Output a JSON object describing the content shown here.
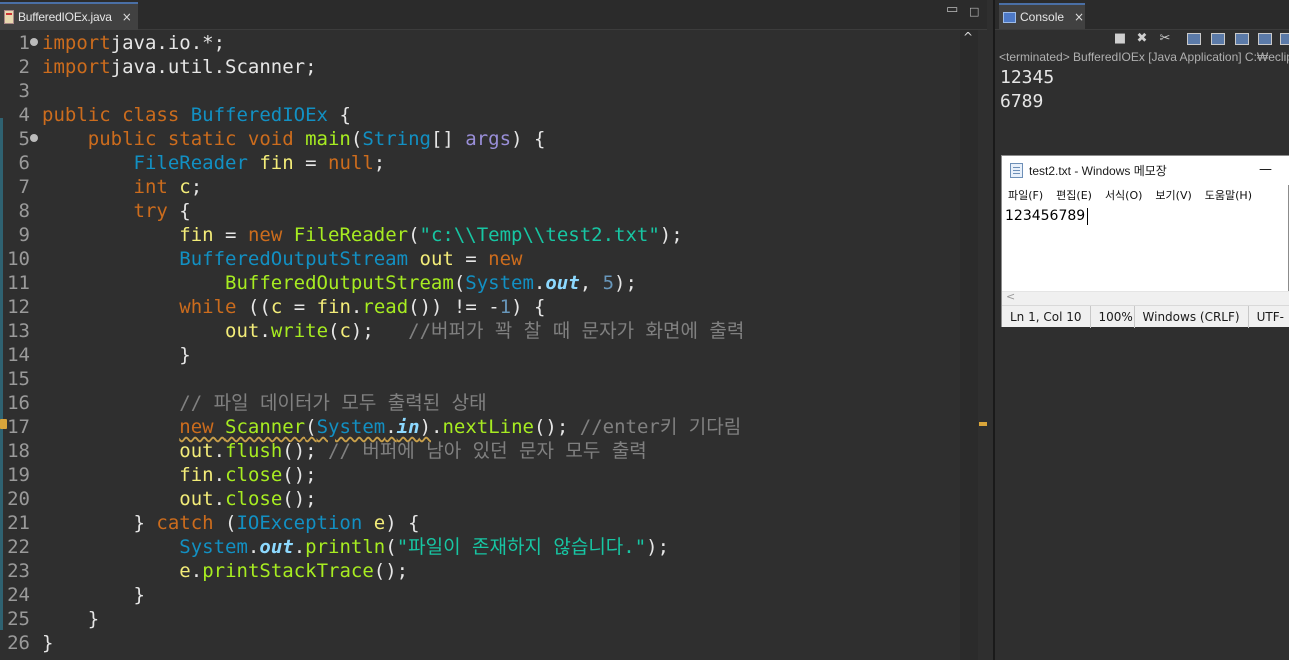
{
  "editor": {
    "tab_label": "BufferedIOEx.java",
    "close_glyph": "×",
    "min_glyph": "▭",
    "max_glyph": "□",
    "lines": [
      {
        "n": "1",
        "fold": true,
        "src": [
          [
            "kw",
            "import"
          ],
          [
            "",
            "java.io.*;"
          ]
        ]
      },
      {
        "n": "2",
        "src": [
          [
            "kw",
            "import"
          ],
          [
            "",
            "java.util.Scanner;"
          ]
        ]
      },
      {
        "n": "3",
        "src": []
      },
      {
        "n": "4",
        "src": [
          [
            "kw",
            "public class "
          ],
          [
            "cls",
            "BufferedIOEx"
          ],
          [
            "",
            " {"
          ]
        ]
      },
      {
        "n": "5",
        "fold": true,
        "src": [
          [
            "",
            "    "
          ],
          [
            "kw",
            "public static void "
          ],
          [
            "fn",
            "main"
          ],
          [
            "",
            "("
          ],
          [
            "cls",
            "String"
          ],
          [
            "",
            "[] "
          ],
          [
            "iface",
            "args"
          ],
          [
            "",
            ") {"
          ]
        ]
      },
      {
        "n": "6",
        "src": [
          [
            "",
            "        "
          ],
          [
            "cls",
            "FileReader "
          ],
          [
            "var",
            "fin"
          ],
          [
            "",
            " = "
          ],
          [
            "kw",
            "null"
          ],
          [
            "",
            ";"
          ]
        ]
      },
      {
        "n": "7",
        "src": [
          [
            "",
            "        "
          ],
          [
            "kw",
            "int "
          ],
          [
            "var",
            "c"
          ],
          [
            "",
            ";"
          ]
        ]
      },
      {
        "n": "8",
        "src": [
          [
            "",
            "        "
          ],
          [
            "kw",
            "try"
          ],
          [
            "",
            " {"
          ]
        ]
      },
      {
        "n": "9",
        "src": [
          [
            "",
            "            "
          ],
          [
            "var",
            "fin"
          ],
          [
            "",
            " = "
          ],
          [
            "kw",
            "new "
          ],
          [
            "fn",
            "FileReader"
          ],
          [
            "",
            "("
          ],
          [
            "str",
            "\"c:\\\\Temp\\\\test2.txt\""
          ],
          [
            "",
            ");"
          ]
        ]
      },
      {
        "n": "10",
        "src": [
          [
            "",
            "            "
          ],
          [
            "cls",
            "BufferedOutputStream "
          ],
          [
            "var",
            "out"
          ],
          [
            "",
            " = "
          ],
          [
            "kw",
            "new"
          ]
        ]
      },
      {
        "n": "11",
        "src": [
          [
            "",
            "                "
          ],
          [
            "fn",
            "BufferedOutputStream"
          ],
          [
            "",
            "("
          ],
          [
            "cls",
            "System"
          ],
          [
            "",
            "."
          ],
          [
            "stat",
            "out"
          ],
          [
            "",
            ", "
          ],
          [
            "num",
            "5"
          ],
          [
            "",
            ");"
          ]
        ]
      },
      {
        "n": "12",
        "src": [
          [
            "",
            "            "
          ],
          [
            "kw",
            "while "
          ],
          [
            "",
            "(("
          ],
          [
            "var",
            "c"
          ],
          [
            "",
            " = "
          ],
          [
            "var",
            "fin"
          ],
          [
            "",
            "."
          ],
          [
            "fn",
            "read"
          ],
          [
            "",
            "()) != -"
          ],
          [
            "num",
            "1"
          ],
          [
            "",
            ") {"
          ]
        ]
      },
      {
        "n": "13",
        "src": [
          [
            "",
            "                "
          ],
          [
            "var",
            "out"
          ],
          [
            "",
            "."
          ],
          [
            "fn",
            "write"
          ],
          [
            "",
            "("
          ],
          [
            "var",
            "c"
          ],
          [
            "",
            ");   "
          ],
          [
            "cmt",
            "//버퍼가 꽉 찰 때 문자가 화면에 출력"
          ]
        ]
      },
      {
        "n": "14",
        "src": [
          [
            "",
            "            }"
          ]
        ]
      },
      {
        "n": "15",
        "src": []
      },
      {
        "n": "16",
        "src": [
          [
            "",
            "            "
          ],
          [
            "cmt",
            "// 파일 데이터가 모두 출력된 상태"
          ]
        ]
      },
      {
        "n": "17",
        "src": [
          [
            "",
            "            "
          ],
          [
            "kwwarn",
            "new "
          ],
          [
            "fnwarn",
            "Scanner"
          ],
          [
            "warn",
            "("
          ],
          [
            "clswarn",
            "System"
          ],
          [
            "warn",
            "."
          ],
          [
            "statwarn",
            "in"
          ],
          [
            "warn",
            ")"
          ],
          [
            "",
            "."
          ],
          [
            "fn",
            "nextLine"
          ],
          [
            "",
            "(); "
          ],
          [
            "cmt",
            "//enter키 기다림"
          ]
        ]
      },
      {
        "n": "18",
        "src": [
          [
            "",
            "            "
          ],
          [
            "var",
            "out"
          ],
          [
            "",
            "."
          ],
          [
            "fn",
            "flush"
          ],
          [
            "",
            "(); "
          ],
          [
            "cmt",
            "// 버퍼에 남아 있던 문자 모두 출력"
          ]
        ]
      },
      {
        "n": "19",
        "src": [
          [
            "",
            "            "
          ],
          [
            "var",
            "fin"
          ],
          [
            "",
            "."
          ],
          [
            "fn",
            "close"
          ],
          [
            "",
            "();"
          ]
        ]
      },
      {
        "n": "20",
        "src": [
          [
            "",
            "            "
          ],
          [
            "var",
            "out"
          ],
          [
            "",
            "."
          ],
          [
            "fn",
            "close"
          ],
          [
            "",
            "();"
          ]
        ]
      },
      {
        "n": "21",
        "src": [
          [
            "",
            "        } "
          ],
          [
            "kw",
            "catch "
          ],
          [
            "",
            "("
          ],
          [
            "cls",
            "IOException "
          ],
          [
            "var",
            "e"
          ],
          [
            "",
            ") {"
          ]
        ]
      },
      {
        "n": "22",
        "src": [
          [
            "",
            "            "
          ],
          [
            "cls",
            "System"
          ],
          [
            "",
            "."
          ],
          [
            "stat",
            "out"
          ],
          [
            "",
            "."
          ],
          [
            "fn",
            "println"
          ],
          [
            "",
            "("
          ],
          [
            "str",
            "\"파일이 존재하지 않습니다.\""
          ],
          [
            "",
            ");"
          ]
        ]
      },
      {
        "n": "23",
        "src": [
          [
            "",
            "            "
          ],
          [
            "var",
            "e"
          ],
          [
            "",
            "."
          ],
          [
            "fn",
            "printStackTrace"
          ],
          [
            "",
            "();"
          ]
        ]
      },
      {
        "n": "24",
        "src": [
          [
            "",
            "        }"
          ]
        ]
      },
      {
        "n": "25",
        "src": [
          [
            "",
            "    }"
          ]
        ]
      },
      {
        "n": "26",
        "src": [
          [
            "",
            "}"
          ]
        ]
      }
    ]
  },
  "console": {
    "tab_label": "Console",
    "close_glyph": "×",
    "status": "<terminated> BufferedIOEx [Java Application] C:₩eclip",
    "output": [
      "12345",
      "6789"
    ],
    "tools": [
      "■",
      "✖",
      "✂"
    ]
  },
  "notepad": {
    "title": "test2.txt - Windows 메모장",
    "min_glyph": "—",
    "menus": [
      "파일(F)",
      "편집(E)",
      "서식(O)",
      "보기(V)",
      "도움말(H)"
    ],
    "content": "123456789",
    "scroll_left_glyph": "<",
    "status": {
      "position": "Ln 1, Col 10",
      "zoom": "100%",
      "line_ending": "Windows (CRLF)",
      "encoding": "UTF-"
    }
  },
  "colors": {
    "keyword": "#cc6c1d",
    "class": "#1290c3",
    "string": "#17c6a3",
    "comment": "#808080",
    "variable": "#f3ec79",
    "method": "#a7ec21"
  }
}
